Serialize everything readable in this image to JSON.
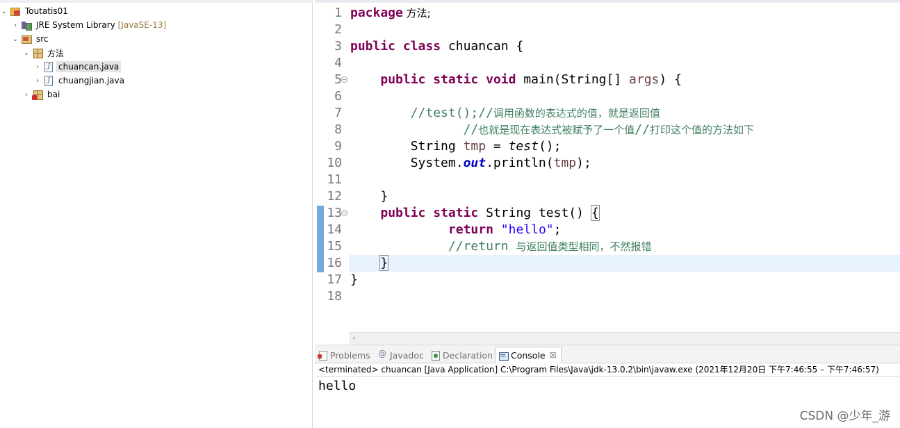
{
  "explorer": {
    "project": "Toutatis01",
    "jre_label": "JRE System Library",
    "jre_decoration": "[JavaSE-13]",
    "src": "src",
    "package": "方法",
    "files": [
      "chuancan.java",
      "chuangjian.java"
    ],
    "package2": "bai"
  },
  "editor": {
    "line_numbers": [
      "1",
      "2",
      "3",
      "4",
      "5",
      "6",
      "7",
      "8",
      "9",
      "10",
      "11",
      "12",
      "13",
      "14",
      "15",
      "16",
      "17",
      "18"
    ],
    "code": {
      "l1_kw": "package",
      "l1_rest": " 方法;",
      "l3_kw1": "public",
      "l3_kw2": "class",
      "l3_rest": " chuancan {",
      "l5_kw1": "public",
      "l5_kw2": "static",
      "l5_kw3": "void",
      "l5_mid": " main(String[] ",
      "l5_var": "args",
      "l5_end": ") {",
      "l7_comment_code": "//test();//",
      "l7_comment_cn": "调用函数的表达式的值，就是返回值",
      "l8_comment_code": "//",
      "l8_comment_cn": "也就是现在表达式被赋予了一个值",
      "l8_comment_code2": "//",
      "l8_comment_cn2": "打印这个值的方法如下",
      "l9_a": "String ",
      "l9_var": "tmp",
      "l9_b": " = ",
      "l9_call": "test",
      "l9_c": "();",
      "l10_a": "System.",
      "l10_out": "out",
      "l10_b": ".println(",
      "l10_var": "tmp",
      "l10_c": ");",
      "l12": "}",
      "l13_kw1": "public",
      "l13_kw2": "static",
      "l13_rest": " String test() ",
      "l13_brace": "{",
      "l14_kw": "return",
      "l14_str": "\"hello\"",
      "l14_end": ";",
      "l15_comment_code": "//return ",
      "l15_comment_cn": "与返回值类型相同，不然报错",
      "l16": "}",
      "l17": "}"
    }
  },
  "console": {
    "tabs": [
      {
        "label": "Problems",
        "icon": "problems-icon"
      },
      {
        "label": "Javadoc",
        "icon": "javadoc-icon"
      },
      {
        "label": "Declaration",
        "icon": "declaration-icon"
      },
      {
        "label": "Console",
        "icon": "console-icon",
        "active": true
      }
    ],
    "close_glyph": "☒",
    "status": "<terminated> chuancan [Java Application] C:\\Program Files\\Java\\jdk-13.0.2\\bin\\javaw.exe  (2021年12月20日 下午7:46:55 – 下午7:46:57)",
    "output": "hello"
  },
  "watermark": "CSDN @少年_游",
  "colors": {
    "keyword": "#7f0055",
    "comment": "#3f7f5f",
    "string": "#2a00ff",
    "field": "#0000c0",
    "local_var": "#6a3e3e",
    "current_line": "#e8f2fe"
  }
}
